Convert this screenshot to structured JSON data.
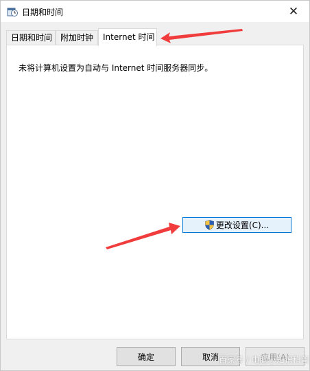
{
  "window": {
    "title": "日期和时间",
    "close_glyph": "✕"
  },
  "tabs": [
    {
      "label": "日期和时间"
    },
    {
      "label": "附加时钟"
    },
    {
      "label": "Internet 时间"
    }
  ],
  "panel": {
    "message": "未将计算机设置为自动与 Internet 时间服务器同步。",
    "change_button": "更改设置(C)..."
  },
  "footer": {
    "ok": "确定",
    "cancel": "取消",
    "apply": "应用(A)"
  },
  "watermark": "百家号 / 电脑小知识科普",
  "colors": {
    "arrow": "#f03c3c",
    "focus_border": "#0078d7"
  },
  "icons": {
    "title": "clock-calendar-icon",
    "shield": "uac-shield-icon",
    "close": "close-icon"
  }
}
